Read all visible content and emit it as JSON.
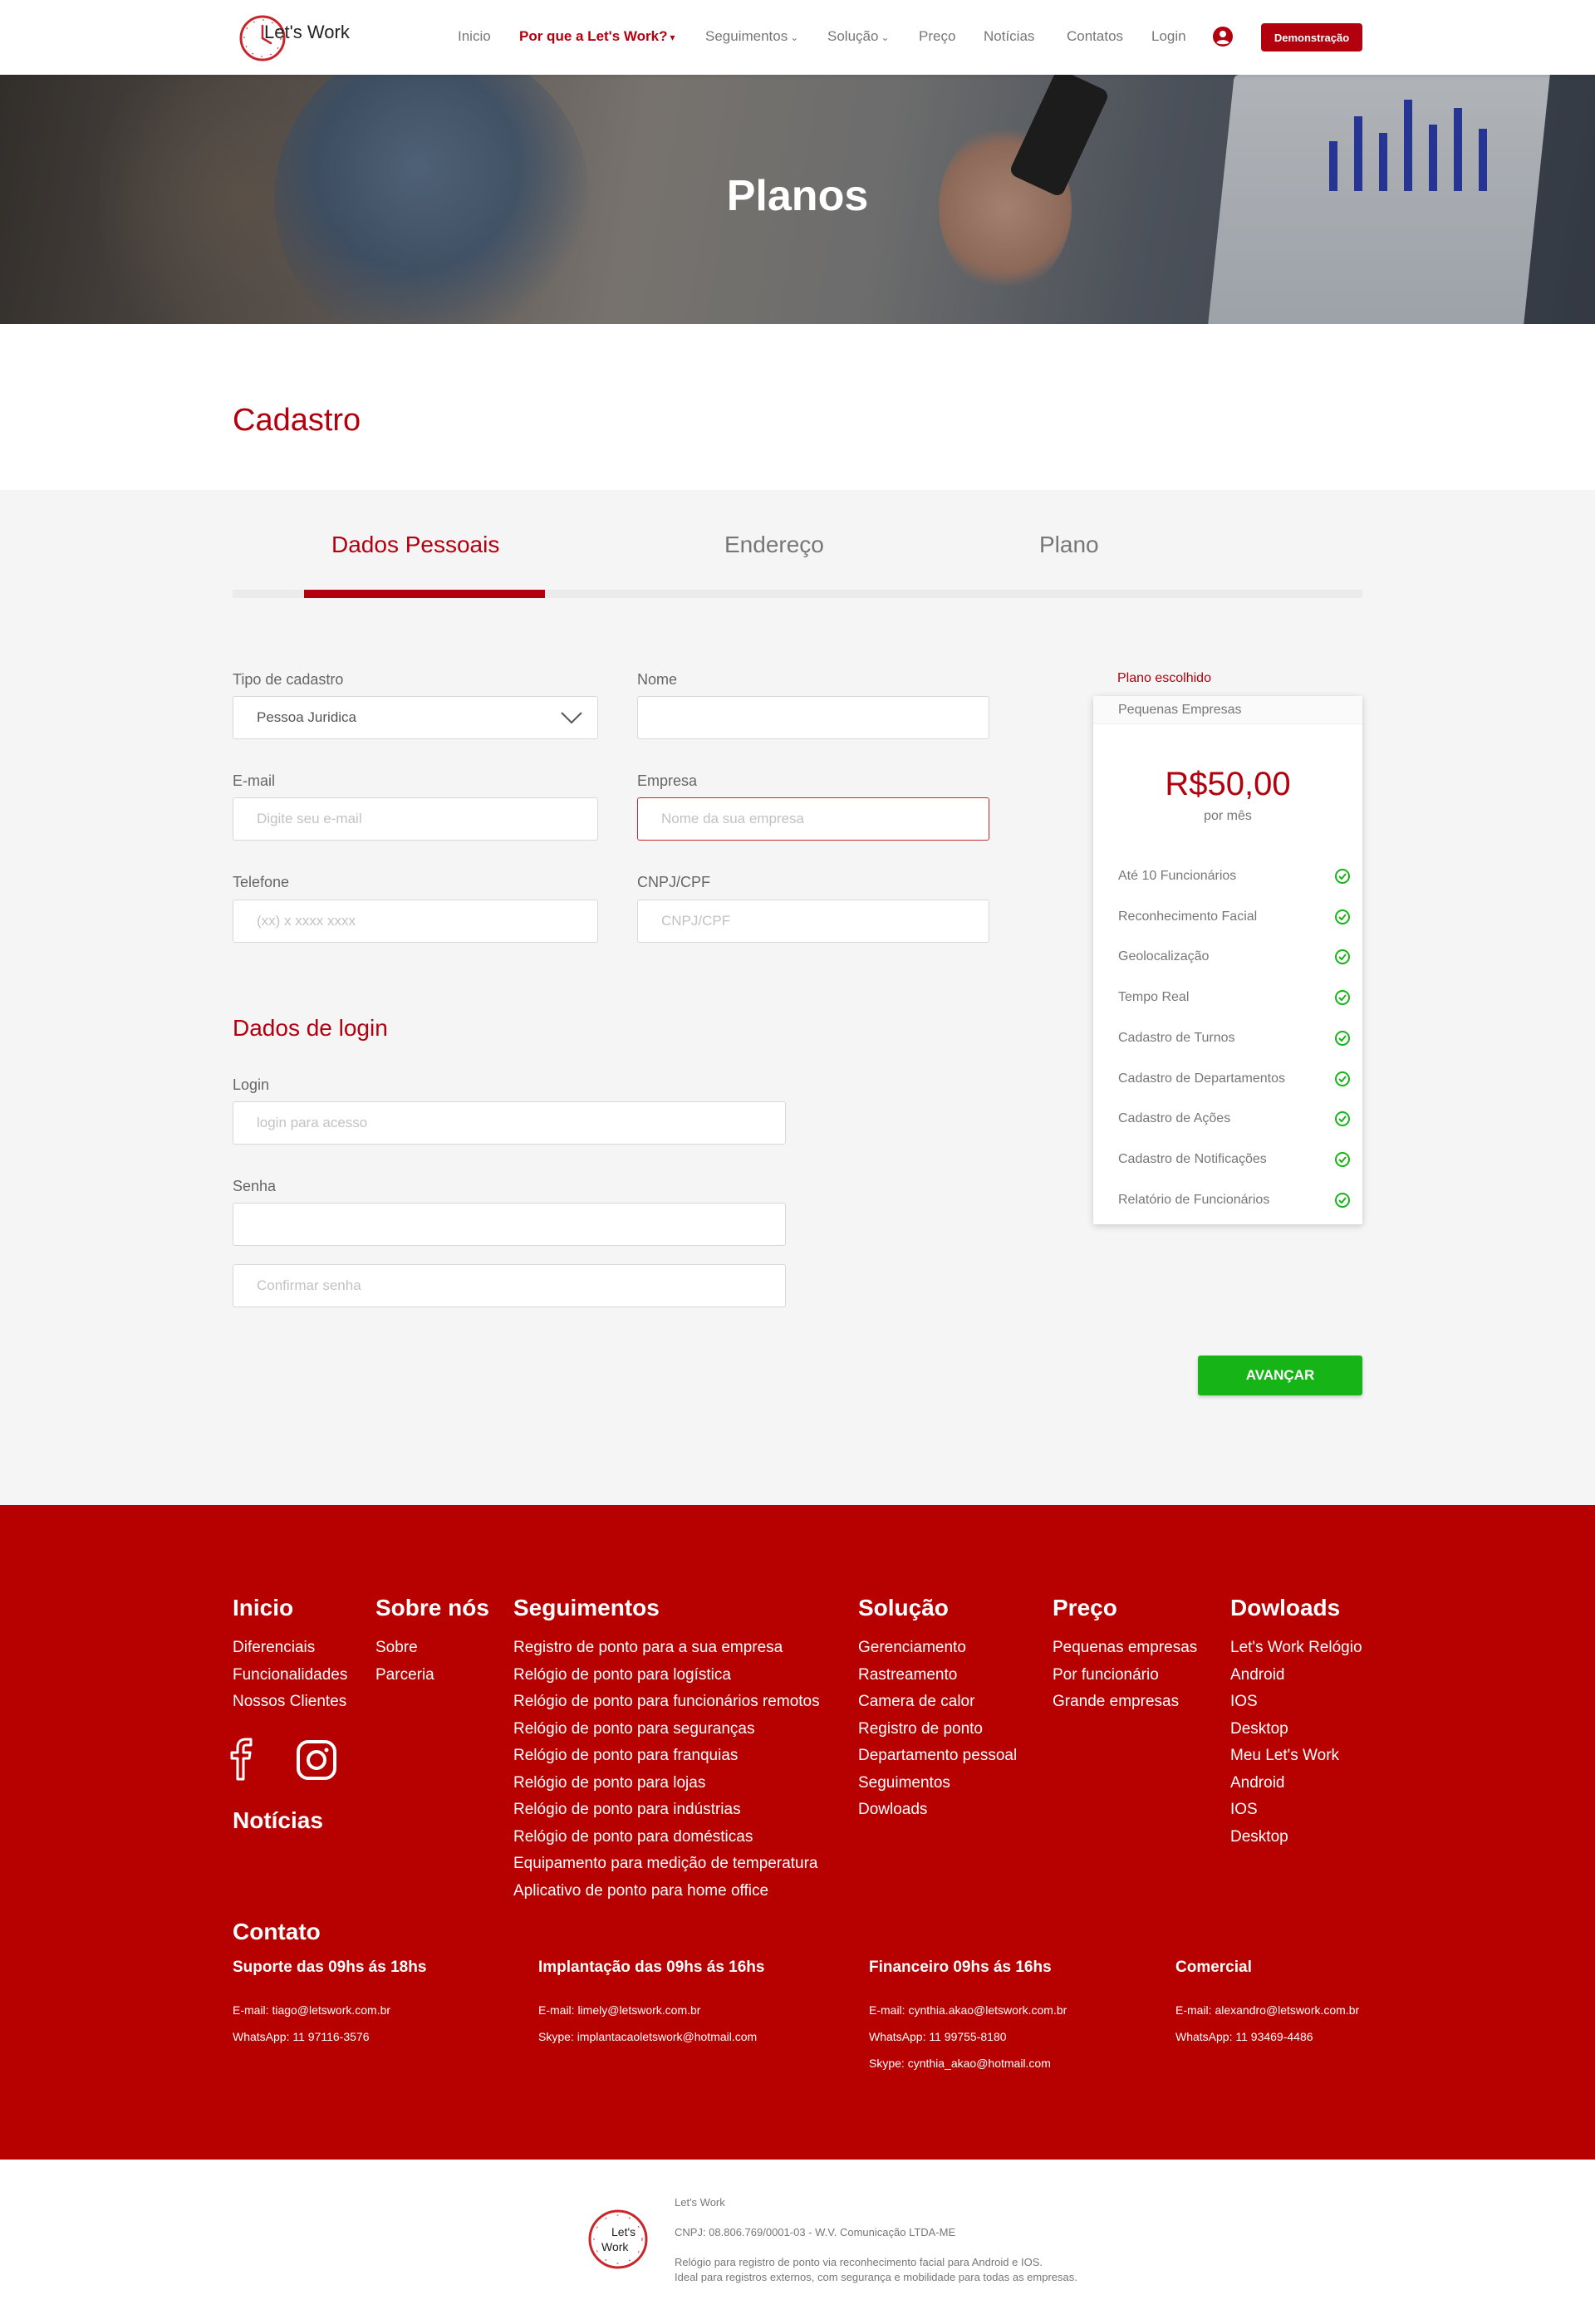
{
  "brand": {
    "name": "Let's Work",
    "color": "#b3000f"
  },
  "nav": {
    "items": [
      "Inicio",
      "Por que a Let's Work?",
      "Seguimentos",
      "Solução",
      "Preço",
      "Notícias",
      "Contatos",
      "Login"
    ],
    "demo": "Demonstração"
  },
  "hero": {
    "title": "Planos"
  },
  "page": {
    "title": "Cadastro"
  },
  "steps": {
    "items": [
      "Dados Pessoais",
      "Endereço",
      "Plano"
    ],
    "active": 0
  },
  "form": {
    "tipo_label": "Tipo de cadastro",
    "tipo_value": "Pessoa Juridica",
    "nome_label": "Nome",
    "nome_value": "",
    "email_label": "E-mail",
    "email_placeholder": "Digite seu e-mail",
    "empresa_label": "Empresa",
    "empresa_placeholder": "Nome da sua empresa",
    "telefone_label": "Telefone",
    "telefone_placeholder": "(xx) x xxxx xxxx",
    "cnpj_label": "CNPJ/CPF",
    "cnpj_placeholder": "CNPJ/CPF",
    "login_section": "Dados de login",
    "login_label": "Login",
    "login_placeholder": "login para acesso",
    "senha_label": "Senha",
    "senha_value": "",
    "confirm_placeholder": "Confirmar senha",
    "next": "AVANÇAR"
  },
  "plan": {
    "label": "Plano escolhido",
    "name": "Pequenas Empresas",
    "price": "R$50,00",
    "period": "por mês",
    "features": [
      "Até 10 Funcionários",
      "Reconhecimento Facial",
      "Geolocalização",
      "Tempo Real",
      "Cadastro de Turnos",
      "Cadastro de Departamentos",
      "Cadastro de Ações",
      "Cadastro de Notificações",
      "Relatório de Funcionários"
    ],
    "check_color": "#17b417"
  },
  "footer": {
    "inicio": {
      "title": "Inicio",
      "links": [
        "Diferenciais",
        "Funcionalidades",
        "Nossos Clientes"
      ]
    },
    "sobre": {
      "title": "Sobre nós",
      "links": [
        "Sobre",
        "Parceria"
      ]
    },
    "seguimentos": {
      "title": "Seguimentos",
      "links": [
        "Registro de ponto para a sua empresa",
        "Relógio de ponto para logística",
        "Relógio de ponto para funcionários remotos",
        "Relógio de ponto para seguranças",
        "Relógio de ponto para franquias",
        "Relógio de ponto para lojas",
        "Relógio de ponto para indústrias",
        "Relógio de ponto para domésticas",
        "Equipamento para medição de temperatura",
        "Aplicativo de ponto para home office"
      ]
    },
    "solucao": {
      "title": "Solução",
      "links": [
        "Gerenciamento",
        "Rastreamento",
        "Camera de calor",
        "Registro de ponto",
        "Departamento pessoal",
        "Seguimentos",
        "Dowloads"
      ]
    },
    "preco": {
      "title": "Preço",
      "links": [
        "Pequenas empresas",
        "Por funcionário",
        "Grande empresas"
      ]
    },
    "downloads": {
      "title": "Dowloads",
      "links": [
        "Let's Work Relógio",
        "Android",
        "IOS",
        "Desktop",
        "Meu Let's Work",
        "Android",
        "IOS",
        "Desktop"
      ]
    },
    "noticias": "Notícias",
    "contato": {
      "title": "Contato",
      "columns": [
        {
          "title": "Suporte das 09hs ás 18hs",
          "lines": [
            "E-mail: tiago@letswork.com.br",
            "WhatsApp: 11 97116-3576"
          ]
        },
        {
          "title": "Implantação das 09hs ás 16hs",
          "lines": [
            "E-mail: limely@letswork.com.br",
            "Skype: implantacaoletswork@hotmail.com"
          ]
        },
        {
          "title": "Financeiro 09hs ás 16hs",
          "lines": [
            "E-mail: cynthia.akao@letswork.com.br",
            "WhatsApp: 11 99755-8180",
            "Skype: cynthia_akao@hotmail.com"
          ]
        },
        {
          "title": "Comercial",
          "lines": [
            "E-mail: alexandro@letswork.com.br",
            "WhatsApp: 11 93469-4486"
          ]
        }
      ]
    }
  },
  "bottom": {
    "company": "Let's Work",
    "cnpj": "CNPJ: 08.806.769/0001-03 - W.V. Comunicação LTDA-ME",
    "desc1": "Relógio para registro de ponto via reconhecimento facial para Android e IOS.",
    "desc2": "Ideal para registros externos, com segurança e mobilidade para todas as empresas."
  }
}
